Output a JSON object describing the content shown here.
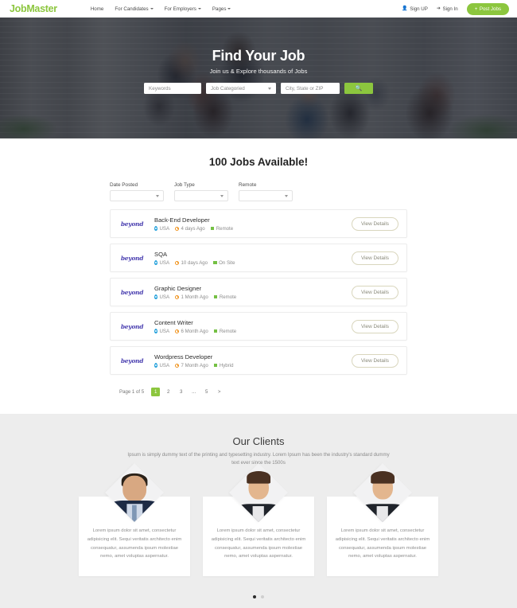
{
  "header": {
    "brand": "JobMaster",
    "nav": [
      {
        "label": "Home",
        "dropdown": false
      },
      {
        "label": "For Candidates",
        "dropdown": true
      },
      {
        "label": "For Employers",
        "dropdown": true
      },
      {
        "label": "Pages",
        "dropdown": true
      }
    ],
    "sign_up": "Sign UP",
    "sign_in": "Sign In",
    "post_jobs": "Post Jobs",
    "accent_color": "#8cc63e"
  },
  "hero": {
    "title": "Find Your Job",
    "subtitle": "Join us & Explore thousands of Jobs",
    "keywords_placeholder": "Keywords",
    "category_value": "Job Categoried",
    "location_placeholder": "City, State or ZIP",
    "search_icon": "search-icon"
  },
  "jobs": {
    "heading": "100 Jobs Available!",
    "filters": [
      {
        "label": "Date Posted",
        "value": ""
      },
      {
        "label": "Job Type",
        "value": ""
      },
      {
        "label": "Remote",
        "value": ""
      }
    ],
    "view_details_label": "View Details",
    "logo_text": "beyond",
    "list": [
      {
        "title": "Back-End Developer",
        "location": "USA",
        "posted": "4 days Ago",
        "mode": "Remote"
      },
      {
        "title": "SQA",
        "location": "USA",
        "posted": "10 days Ago",
        "mode": "On Site"
      },
      {
        "title": "Graphic Designer",
        "location": "USA",
        "posted": "1 Month Ago",
        "mode": "Remote"
      },
      {
        "title": "Content Writer",
        "location": "USA",
        "posted": "6 Month Ago",
        "mode": "Remote"
      },
      {
        "title": "Wordpress Developer",
        "location": "USA",
        "posted": "7 Month Ago",
        "mode": "Hybrid"
      }
    ],
    "pagination": {
      "info": "Page 1 of 5",
      "pages": [
        "1",
        "2",
        "3",
        "...",
        "5",
        ">"
      ],
      "active_index": 0
    }
  },
  "clients": {
    "title": "Our Clients",
    "subtitle": "Ipsum is simply dummy text of the printing and typesetting industry. Lorem Ipsum has been the industry's standard dummy text ever since the 1500s",
    "testimonials": [
      {
        "text": "Lorem ipsum dolor sit amet, consectetur adipisicing elit. Sequi veritatis architecto enim consequatur, assumenda ipsum molestiae nemo, amet voluptas aspernatur.",
        "avatar": "male-avatar"
      },
      {
        "text": "Lorem ipsum dolor sit amet, consectetur adipisicing elit. Sequi veritatis architecto enim consequatur, assumenda ipsum molestiae nemo, amet voluptas aspernatur.",
        "avatar": "female-avatar"
      },
      {
        "text": "Lorem ipsum dolor sit amet, consectetur adipisicing elit. Sequi veritatis architecto enim consequatur, assumenda ipsum molestiae nemo, amet voluptas aspernatur.",
        "avatar": "female-avatar"
      }
    ],
    "carousel_dots": 2,
    "active_dot": 0
  }
}
